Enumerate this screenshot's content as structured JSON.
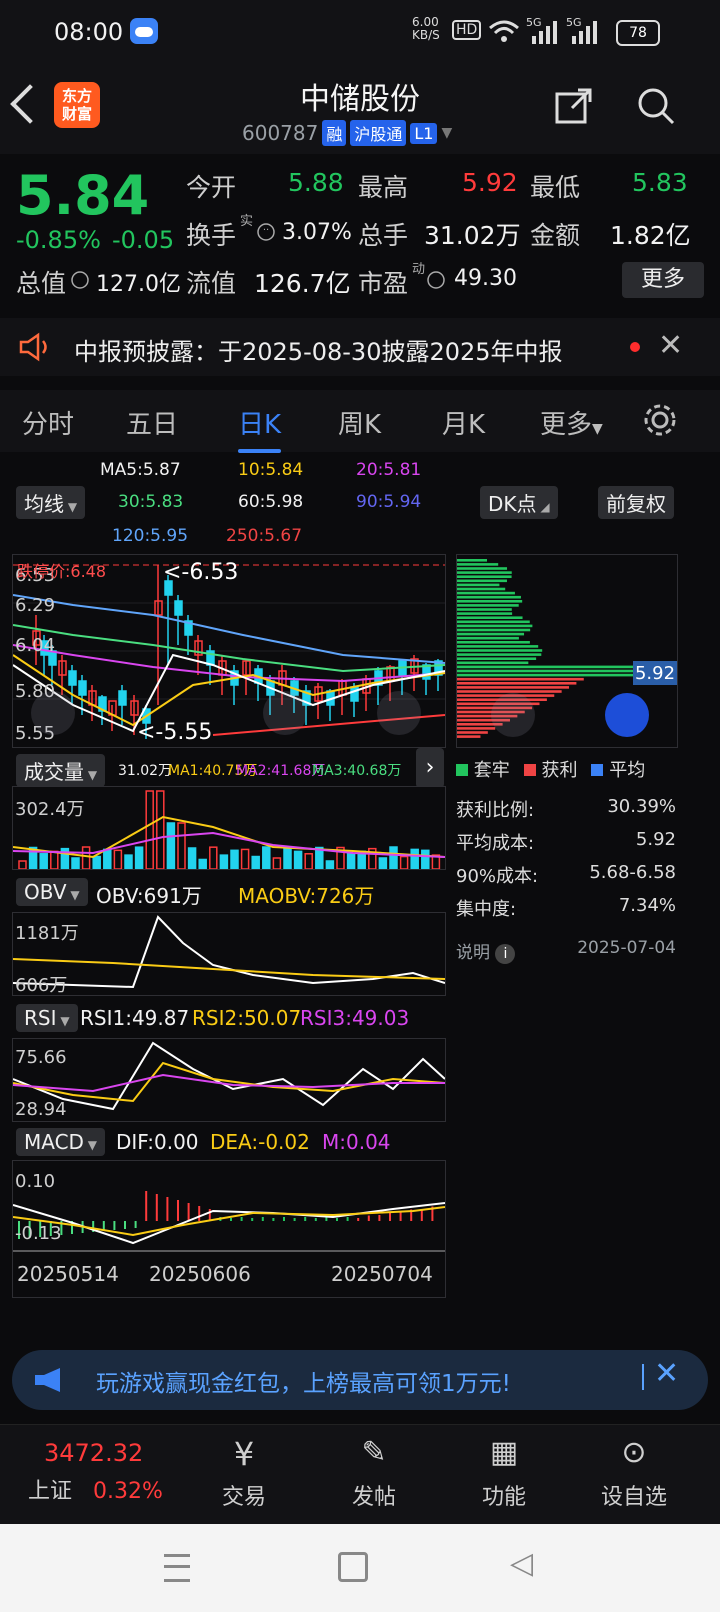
{
  "status": {
    "time": "08:00",
    "net_speed": "6.00\nKB/S",
    "hd": "HD",
    "sig1": "5G",
    "sig2": "5G",
    "battery": "78"
  },
  "header": {
    "app_logo": "东方\n财富",
    "stock_name": "中储股份",
    "code": "600787",
    "tag_margin": "融",
    "tag_connect": "沪股通",
    "tag_level": "L1"
  },
  "quote": {
    "price": "5.84",
    "pct": "-0.85%",
    "change": "-0.05",
    "open_label": "今开",
    "open": "5.88",
    "high_label": "最高",
    "high": "5.92",
    "low_label": "最低",
    "low": "5.83",
    "turnover_label": "换手",
    "turnover_sup": "实",
    "turnover": "3.07%",
    "volume_label": "总手",
    "volume": "31.02万",
    "amount_label": "金额",
    "amount": "1.82亿",
    "mcap_label": "总值",
    "mcap": "127.0亿",
    "float_label": "流值",
    "float": "126.7亿",
    "pe_label": "市盈",
    "pe_sup": "动",
    "pe": "49.30",
    "more": "更多"
  },
  "notice": {
    "text": "中报预披露：于2025-08-30披露2025年中报"
  },
  "tabs": [
    "分时",
    "五日",
    "日K",
    "周K",
    "月K",
    "更多"
  ],
  "ma_legend": {
    "toggle": "均线",
    "dk": "DK点",
    "adjust": "前复权",
    "ma5": "MA5:5.87",
    "ma10": "10:5.84",
    "ma20": "20:5.81",
    "ma30": "30:5.83",
    "ma60": "60:5.98",
    "ma90": "90:5.94",
    "ma120": "120:5.95",
    "ma250": "250:5.67"
  },
  "kline": {
    "yticks": [
      "6.53",
      "6.29",
      "6.04",
      "5.80",
      "5.55"
    ],
    "limit_down": "跌停价:6.48",
    "hi_mark": "<-6.53",
    "lo_mark": "<-5.55"
  },
  "volume": {
    "toggle": "成交量",
    "v": "31.02万",
    "ma1": "MA1:40.75万",
    "ma2": "MA2:41.68万",
    "ma3": "MA3:40.68万",
    "ytick": "302.4万"
  },
  "obv": {
    "toggle": "OBV",
    "obv": "OBV:691万",
    "maobv": "MAOBV:726万",
    "yticks": [
      "1181万",
      "606万"
    ]
  },
  "rsi": {
    "toggle": "RSI",
    "rsi1": "RSI1:49.87",
    "rsi2": "RSI2:50.07",
    "rsi3": "RSI3:49.03",
    "yticks": [
      "75.66",
      "28.94"
    ]
  },
  "macd": {
    "toggle": "MACD",
    "dif": "DIF:0.00",
    "dea": "DEA:-0.02",
    "m": "M:0.04",
    "yticks": [
      "0.10",
      "-0.13"
    ]
  },
  "dates": [
    "20250514",
    "20250606",
    "20250704"
  ],
  "chips": {
    "price_tag": "5.92",
    "legend": [
      "套牢",
      "获利",
      "平均"
    ],
    "rows": [
      {
        "label": "获利比例:",
        "value": "30.39%"
      },
      {
        "label": "平均成本:",
        "value": "5.92"
      },
      {
        "label": "90%成本:",
        "value": "5.68-6.58"
      },
      {
        "label": "集中度:",
        "value": "7.34%"
      }
    ],
    "note": "说明",
    "date": "2025-07-04"
  },
  "banner": {
    "text": "玩游戏赢现金红包，上榜最高可领1万元!"
  },
  "bottom": {
    "index_value": "3472.32",
    "index_name": "上证",
    "index_pct": "0.32%",
    "items": [
      "交易",
      "发帖",
      "功能",
      "设自选"
    ]
  },
  "colors": {
    "up": "#ff3b3b",
    "down": "#22c55e",
    "accent": "#3b82f6"
  }
}
